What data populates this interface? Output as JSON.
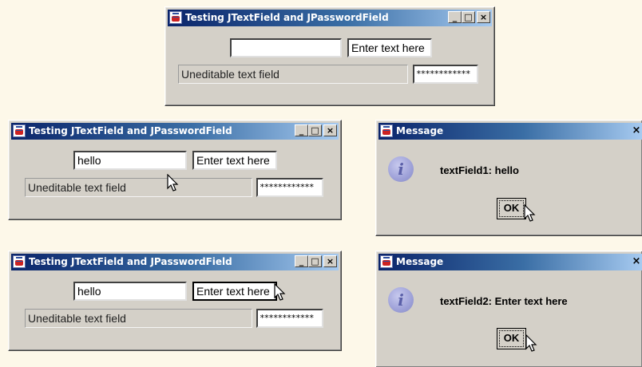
{
  "window_title": "Testing JTextField and JPasswordField",
  "dialog_title": "Message",
  "controls": {
    "minimize": "_",
    "maximize": "□",
    "close": "×"
  },
  "icons": {
    "app": "java-cup-icon",
    "info": "information-icon",
    "cursor": "mouse-pointer-icon"
  },
  "colors": {
    "titlebar_start": "#0a246a",
    "titlebar_end": "#a6caf0",
    "window_bg": "#d4d0c8",
    "page_bg": "#fdf8e9"
  },
  "windows": [
    {
      "text_field_1": "",
      "text_field_2": "Enter text here",
      "text_field_3": "Uneditable text field",
      "password_field": "************"
    },
    {
      "text_field_1": "hello",
      "text_field_2": "Enter text here",
      "text_field_3": "Uneditable text field",
      "password_field": "************"
    },
    {
      "text_field_1": "hello",
      "text_field_2": "Enter text here",
      "text_field_3": "Uneditable text field",
      "password_field": "************"
    }
  ],
  "dialogs": [
    {
      "message": "textField1: hello",
      "ok_label": "OK"
    },
    {
      "message": "textField2: Enter text here",
      "ok_label": "OK"
    }
  ]
}
